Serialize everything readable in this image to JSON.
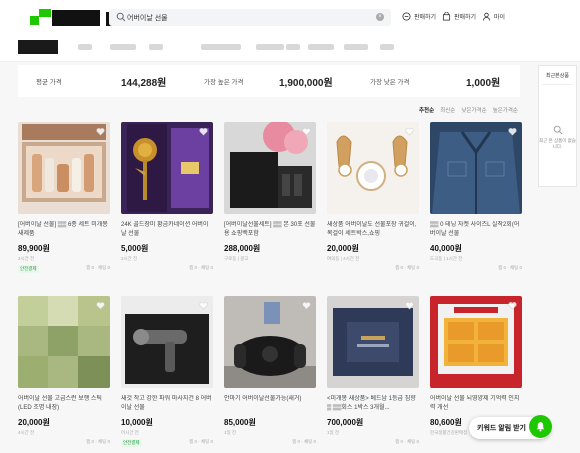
{
  "header": {
    "search_value": "어버이날 선물",
    "nav": {
      "sell_label": "판매하기",
      "store_label": "판매하기",
      "my_label": "마이"
    }
  },
  "price_summary": {
    "avg_label": "평균 가격",
    "avg_value": "144,288원",
    "high_label": "가장 높은 가격",
    "high_value": "1,900,000원",
    "low_label": "가장 낮은 가격",
    "low_value": "1,000원"
  },
  "sort": {
    "items": [
      "추천순",
      "최신순",
      "낮은가격순",
      "높은가격순"
    ],
    "active": "추천순"
  },
  "recent": {
    "title": "최근본상품",
    "message": "최근 본 상품이 없습니다."
  },
  "products": [
    {
      "title": "[어버이날 선물] ▒▒ 6종 세트 미개봉 새제품",
      "price": "89,900원",
      "meta": "2시간 전",
      "badge": "안전결제",
      "right": "찜 0 · 채팅 0"
    },
    {
      "title": "24K 골드장미 황금카네이션 어버이날 선물",
      "price": "5,000원",
      "meta": "2시간 전",
      "badge": "",
      "right": "찜 0 · 채팅 0"
    },
    {
      "title": "[어버이날선물세트] ▒▒ 본 30포 선물용 쇼핑백포함",
      "price": "288,000원",
      "meta": "구로동 | 광고",
      "badge": "",
      "right": ""
    },
    {
      "title": "새상품 어버이날도 선물포장 귀걸이,목걸이 세트박스,쇼핑",
      "price": "20,000원",
      "meta": "여의동 | 4시간 전",
      "badge": "",
      "right": "찜 0 · 채팅 0"
    },
    {
      "title": "▒▒ 0 테닝 자켓 사이즈L 실착2회(어버이날 선물",
      "price": "40,000원",
      "meta": "도곡동 | 1시간 전",
      "badge": "",
      "right": "찜 0 · 채팅 0"
    },
    {
      "title": "어버이날 선물 고급스런 보행 스틱 (LED 조명 내장)",
      "price": "20,000원",
      "meta": "4시간 전",
      "badge": "",
      "right": "찜 0 · 채팅 0"
    },
    {
      "title": "새것 작고 강한 파워 마사지건 8 어버이날 선물",
      "price": "10,000원",
      "meta": "어시간 전",
      "badge": "안전결제",
      "right": "찜 0 · 채팅 0"
    },
    {
      "title": "안마기 어버이날선물가능(새거)",
      "price": "85,000원",
      "meta": "1일 전",
      "badge": "",
      "right": "찜 0 · 채팅 0"
    },
    {
      "title": "<미개봉 새상품> 베드남 1등급 침향 ▒ ▒▒회스 1박스 3개월...",
      "price": "700,000원",
      "meta": "1일 전",
      "badge": "",
      "right": "찜 0 · 채팅 0"
    },
    {
      "title": "어버이날 선물 뇌영양제 기억력 인지력 개선",
      "price": "80,600원",
      "meta": "한국생활건강판매점",
      "badge": "",
      "right": ""
    }
  ],
  "alert_button_label": "키워드 알림 받기",
  "colors": {
    "brand_green": "#1ec800",
    "safe_badge": "#1e9e3b"
  }
}
